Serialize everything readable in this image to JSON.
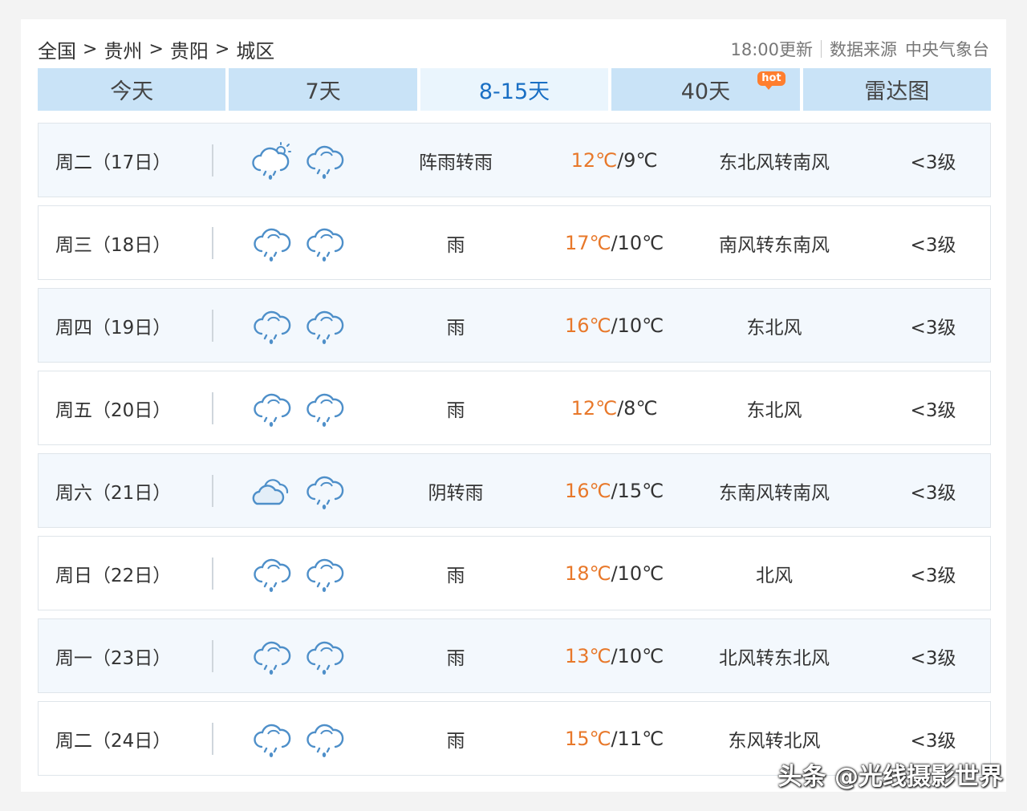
{
  "breadcrumb": [
    "全国",
    "贵州",
    "贵阳",
    "城区"
  ],
  "breadcrumb_separator": ">",
  "update_time": "18:00更新",
  "source_label": "数据来源",
  "source_name": "中央气象台",
  "tabs": [
    {
      "label": "今天"
    },
    {
      "label": "7天"
    },
    {
      "label": "8-15天"
    },
    {
      "label": "40天",
      "badge": "hot"
    },
    {
      "label": "雷达图"
    }
  ],
  "active_tab": "8-15天",
  "colors": {
    "accent": "#1a6fc4",
    "tab_bg": "#c9e3f7",
    "high_temp": "#e8782a",
    "hot_badge": "#ff7e2e",
    "icon": "#4e8fc9"
  },
  "days": [
    {
      "date": "周二（17日）",
      "icon_day": "shower-sun-icon",
      "icon_night": "rain-icon",
      "desc": "阵雨转雨",
      "high": "12℃",
      "low": "9℃",
      "wind": "东北风转南风",
      "level": "<3级"
    },
    {
      "date": "周三（18日）",
      "icon_day": "rain-icon",
      "icon_night": "rain-icon",
      "desc": "雨",
      "high": "17℃",
      "low": "10℃",
      "wind": "南风转东南风",
      "level": "<3级"
    },
    {
      "date": "周四（19日）",
      "icon_day": "rain-icon",
      "icon_night": "rain-icon",
      "desc": "雨",
      "high": "16℃",
      "low": "10℃",
      "wind": "东北风",
      "level": "<3级"
    },
    {
      "date": "周五（20日）",
      "icon_day": "rain-icon",
      "icon_night": "rain-icon",
      "desc": "雨",
      "high": "12℃",
      "low": "8℃",
      "wind": "东北风",
      "level": "<3级"
    },
    {
      "date": "周六（21日）",
      "icon_day": "overcast-icon",
      "icon_night": "rain-icon",
      "desc": "阴转雨",
      "high": "16℃",
      "low": "15℃",
      "wind": "东南风转南风",
      "level": "<3级"
    },
    {
      "date": "周日（22日）",
      "icon_day": "rain-icon",
      "icon_night": "rain-icon",
      "desc": "雨",
      "high": "18℃",
      "low": "10℃",
      "wind": "北风",
      "level": "<3级"
    },
    {
      "date": "周一（23日）",
      "icon_day": "rain-icon",
      "icon_night": "rain-icon",
      "desc": "雨",
      "high": "13℃",
      "low": "10℃",
      "wind": "北风转东北风",
      "level": "<3级"
    },
    {
      "date": "周二（24日）",
      "icon_day": "rain-icon",
      "icon_night": "rain-icon",
      "desc": "雨",
      "high": "15℃",
      "low": "11℃",
      "wind": "东风转北风",
      "level": "<3级"
    }
  ],
  "temp_separator": "/",
  "watermark": "头条 @光线摄影世界"
}
